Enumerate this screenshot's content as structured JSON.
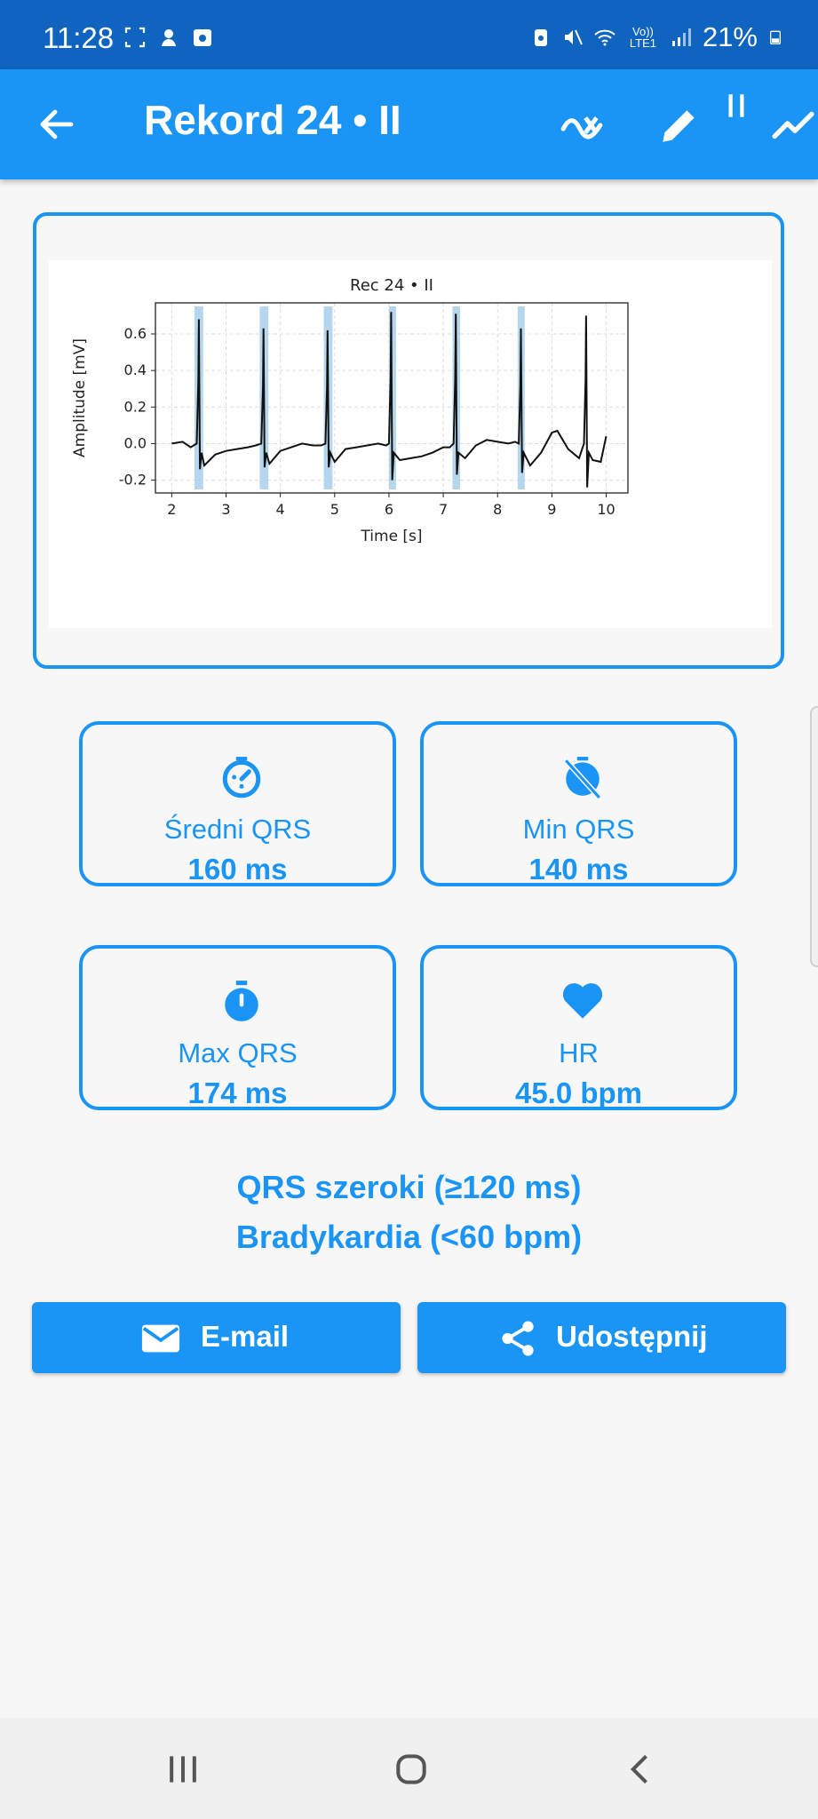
{
  "status_bar": {
    "time": "11:28",
    "battery": "21%",
    "network_label": "Vo)) LTE1",
    "icons": [
      "screenshot-icon",
      "bixby-icon",
      "camera-app-icon",
      "battery-saver-icon",
      "mute-icon",
      "wifi-icon",
      "signal-icon",
      "battery-icon"
    ]
  },
  "app_bar": {
    "title": "Rekord 24 • II",
    "icons": [
      "back-arrow-icon",
      "filter-wave-icon",
      "edit-pencil-icon",
      "pause-icon",
      "trend-line-icon"
    ]
  },
  "chart_data": {
    "type": "line",
    "title": "Rec 24 • II",
    "xlabel": "Time [s]",
    "ylabel": "Amplitude [mV]",
    "xlim": [
      1.7,
      10.4
    ],
    "ylim": [
      -0.27,
      0.77
    ],
    "xticks": [
      "2",
      "3",
      "4",
      "5",
      "6",
      "7",
      "8",
      "9",
      "10"
    ],
    "yticks": [
      "-0.2",
      "0.0",
      "0.2",
      "0.4",
      "0.6"
    ],
    "grid": true,
    "qrs_highlights": [
      {
        "start": 2.42,
        "end": 2.58
      },
      {
        "start": 3.62,
        "end": 3.78
      },
      {
        "start": 4.8,
        "end": 4.96
      },
      {
        "start": 6.0,
        "end": 6.13
      },
      {
        "start": 7.17,
        "end": 7.31
      },
      {
        "start": 8.37,
        "end": 8.5
      }
    ],
    "beats": [
      {
        "t": 2.5,
        "peak": 0.68,
        "trough": -0.14
      },
      {
        "t": 3.69,
        "peak": 0.63,
        "trough": -0.13
      },
      {
        "t": 4.87,
        "peak": 0.62,
        "trough": -0.13
      },
      {
        "t": 6.04,
        "peak": 0.72,
        "trough": -0.2
      },
      {
        "t": 7.23,
        "peak": 0.71,
        "trough": -0.17
      },
      {
        "t": 8.43,
        "peak": 0.63,
        "trough": -0.16
      },
      {
        "t": 9.63,
        "peak": 0.7,
        "trough": -0.24
      }
    ],
    "baseline": {
      "x": [
        2.0,
        2.2,
        2.35,
        2.6,
        2.8,
        3.0,
        3.2,
        3.4,
        3.55,
        3.8,
        4.0,
        4.2,
        4.4,
        4.6,
        4.75,
        5.0,
        5.2,
        5.4,
        5.6,
        5.8,
        5.95,
        6.2,
        6.4,
        6.6,
        6.8,
        7.0,
        7.12,
        7.4,
        7.6,
        7.8,
        8.0,
        8.2,
        8.32,
        8.6,
        8.8,
        9.0,
        9.1,
        9.3,
        9.5,
        9.75,
        9.9,
        10.0
      ],
      "y": [
        0.0,
        0.01,
        -0.02,
        -0.12,
        -0.06,
        -0.04,
        -0.03,
        -0.02,
        -0.01,
        -0.11,
        -0.04,
        -0.02,
        0.0,
        -0.01,
        -0.01,
        -0.1,
        -0.03,
        -0.02,
        -0.01,
        0.0,
        -0.01,
        -0.09,
        -0.08,
        -0.07,
        -0.05,
        -0.02,
        -0.02,
        -0.08,
        -0.01,
        0.02,
        0.01,
        0.0,
        0.01,
        -0.12,
        -0.05,
        0.06,
        0.07,
        -0.03,
        -0.08,
        -0.09,
        -0.1,
        0.04
      ]
    }
  },
  "metrics": [
    {
      "label": "Średni QRS",
      "value": "160 ms",
      "icon": "timer-clock-icon"
    },
    {
      "label": "Min QRS",
      "value": "140 ms",
      "icon": "timer-off-icon"
    },
    {
      "label": "Max QRS",
      "value": "174 ms",
      "icon": "stopwatch-icon"
    },
    {
      "label": "HR",
      "value": "45.0 bpm",
      "icon": "heart-icon"
    }
  ],
  "diagnoses": [
    "QRS szeroki (≥120 ms)",
    "Bradykardia (<60 bpm)"
  ],
  "actions": {
    "email_label": "E-mail",
    "share_label": "Udostępnij"
  },
  "colors": {
    "primary": "#1a94f5",
    "status_bar": "#0f64c0",
    "background": "#f7f7f7",
    "qrs_highlight": "#b5d6ec"
  },
  "nav_bar": {
    "icons": [
      "recent-apps-icon",
      "home-icon",
      "back-icon"
    ]
  }
}
